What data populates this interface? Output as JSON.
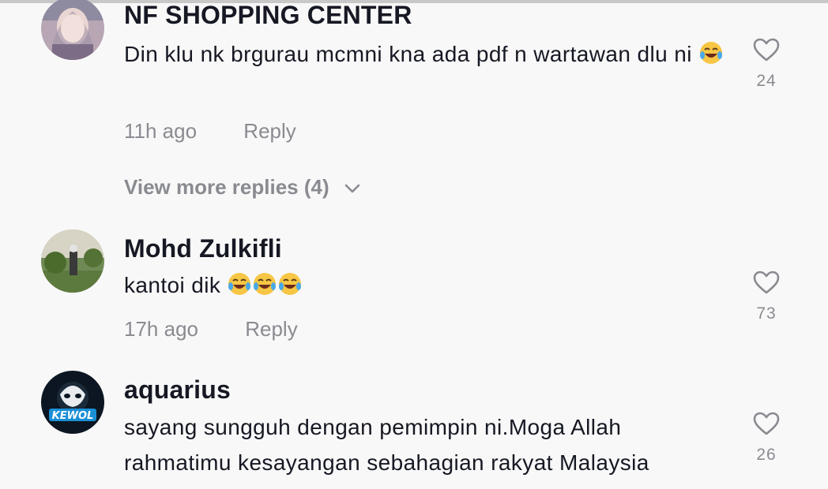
{
  "comments": [
    {
      "username": "NF SHOPPING CENTER",
      "text": "Din klu nk brgurau mcmni kna ada pdf n wartawan dlu ni",
      "emoji": "😂",
      "time": "11h ago",
      "reply": "Reply",
      "likes": "24",
      "more_replies": "View more replies (4)"
    },
    {
      "username": "Mohd Zulkifli",
      "text": "kantoi dik",
      "emoji": "😂😂😂",
      "time": "17h ago",
      "reply": "Reply",
      "likes": "73"
    },
    {
      "username": "aquarius",
      "text": "sayang sungguh dengan pemimpin ni.Moga Allah rahmatimu kesayangan sebahagian rakyat Malaysia",
      "avatar_text": "KEWOL",
      "likes": "26"
    }
  ],
  "icons": {
    "like": "heart-outline-icon",
    "expand": "chevron-down-icon",
    "emoji": "face-with-tears-of-joy-emoji"
  },
  "colors": {
    "text": "#161823",
    "secondary": "#8a8b91",
    "background": "#f8f8f8"
  }
}
